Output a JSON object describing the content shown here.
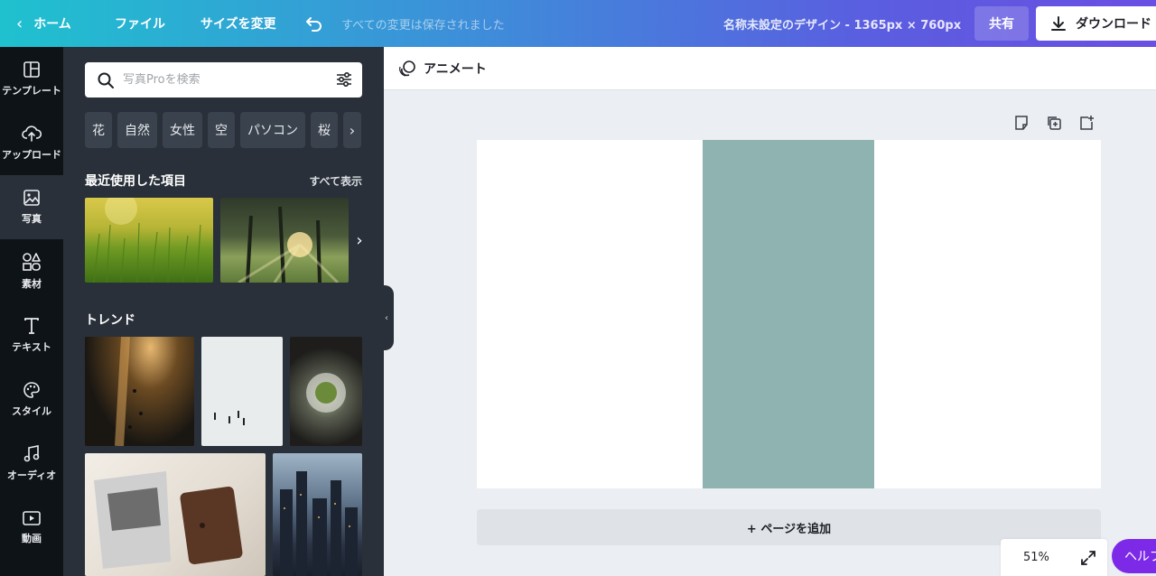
{
  "topbar": {
    "home_label": "ホーム",
    "file_label": "ファイル",
    "resize_label": "サイズを変更",
    "saved_status": "すべての変更は保存されました",
    "design_title": "名称未設定のデザイン - 1365px × 760px",
    "share_label": "共有",
    "download_label": "ダウンロード"
  },
  "rail": {
    "items": [
      {
        "label": "テンプレート",
        "icon": "template-icon"
      },
      {
        "label": "アップロード",
        "icon": "upload-cloud-icon"
      },
      {
        "label": "写真",
        "icon": "photo-icon",
        "active": true
      },
      {
        "label": "素材",
        "icon": "elements-icon"
      },
      {
        "label": "テキスト",
        "icon": "text-icon"
      },
      {
        "label": "スタイル",
        "icon": "palette-icon"
      },
      {
        "label": "オーディオ",
        "icon": "music-note-icon"
      },
      {
        "label": "動画",
        "icon": "video-icon"
      }
    ]
  },
  "panel": {
    "search_placeholder": "写真Proを検索",
    "chips": [
      "花",
      "自然",
      "女性",
      "空",
      "パソコン",
      "桜"
    ],
    "recent_title": "最近使用した項目",
    "see_all_label": "すべて表示",
    "trend_title": "トレンド"
  },
  "canvas": {
    "animate_label": "アニメート",
    "add_page_label": "+ ページを追加",
    "stripe_color": "#8fb3b0"
  },
  "footer": {
    "zoom_level": "51%",
    "help_label": "ヘルプ"
  },
  "colors": {
    "accent": "#7d2ae8",
    "rail_bg": "#0e1318",
    "panel_bg": "#293039"
  }
}
